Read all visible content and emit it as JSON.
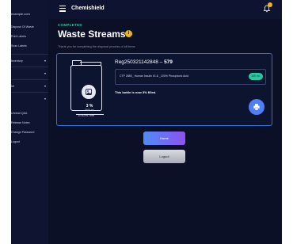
{
  "app": {
    "title": "Chemishield"
  },
  "sidebar": {
    "email": "example.com",
    "items_top": [
      "Dispose Of Waste",
      "Print Labels",
      "Scan Labels"
    ],
    "groups": [
      "Inventory",
      "",
      "Inf",
      ""
    ],
    "items_bottom": [
      "Unread Q&A",
      "Release Notes",
      "Change Password",
      "Logout"
    ]
  },
  "page": {
    "status": "COMPLETED",
    "title": "Waste Streams",
    "info_badge": "i",
    "subtitle": "Thank you for completing the disposal process of all items"
  },
  "bottle": {
    "fill_percent_label": "3 %",
    "fill_volume_label": "1500 ml.",
    "free_label": "5750 ml. free",
    "fill_fraction": 0.03
  },
  "waste": {
    "reg_id": "Reg250321142848",
    "reg_count": "579",
    "chemical": "CTP 2880_ Human Insulin IG & _100% Phosphoric Acid",
    "chemical_pill": "100 ml.",
    "fill_message": "This bottle is now 3% filled."
  },
  "buttons": {
    "home": "Home",
    "logout": "Logout"
  },
  "colors": {
    "accent_green": "#27c9a4",
    "accent_blue": "#4f7ef7",
    "badge_yellow": "#f2b705"
  }
}
